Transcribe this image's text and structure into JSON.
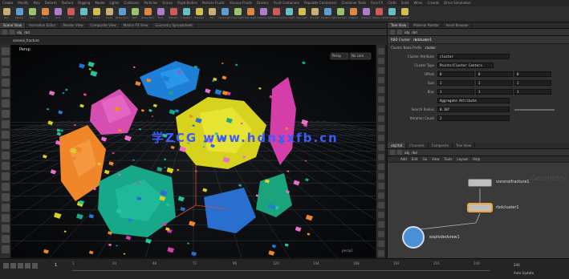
{
  "shelf": {
    "tabs": [
      "Create",
      "Modify",
      "Poly",
      "Deform",
      "Texture",
      "Rigging",
      "Model",
      "Lights",
      "Collisions",
      "Particles",
      "Grains",
      "Rigid Bodies",
      "Particle Fluids",
      "Viscous Fluids",
      "Oceans",
      "Fluid Containers",
      "Populate Containers",
      "Container Tools",
      "Pyro FX",
      "Cloth",
      "Solid",
      "Wires",
      "Crowds",
      "Drive Simulation"
    ],
    "tools": [
      "Box",
      "Sphere",
      "Tube",
      "Torus",
      "Grid",
      "Null",
      "Line",
      "Circle",
      "Curve",
      "Draw Curve",
      "Path",
      "Spray Paint",
      "Font",
      "Platonic",
      "L-System",
      "Metaball",
      "File",
      "Spot Light",
      "Area Light",
      "Geo Light",
      "Volume Light",
      "Distant Light",
      "Env Light",
      "Sky Light",
      "GI Light",
      "Caustic Light",
      "Portal Light",
      "Ambient",
      "Camera",
      "Stereo Cam",
      "VR Camera",
      "Switcher"
    ]
  },
  "scene_view": {
    "tabs": [
      "Scene View",
      "Animation Editor",
      "Render View",
      "Composite View",
      "Motion FX View",
      "Geometry Spreadsheet"
    ],
    "path": "voronoi_fracture",
    "obj_label": "obj",
    "node_label": "rbd",
    "viewport_title": "Persp",
    "camera_menu": "No cam",
    "watermark": "学ZCG  www.hdnxxfb.cn",
    "view_label": "persp1"
  },
  "params": {
    "tabs": [
      "Tree View",
      "Material Palette",
      "Asset Browser"
    ],
    "path_obj": "obj",
    "path_node": "rbd",
    "node_type": "RBD Cluster",
    "node_name": "rbdcluster1",
    "sub_label": "Cluster Node Prefix",
    "sub_value": "cluster",
    "rows": [
      {
        "label": "Cluster Attribute",
        "values": [
          "cluster"
        ]
      },
      {
        "label": "Cluster Type",
        "values": [
          "Points/Cluster Centers"
        ]
      },
      {
        "label": "Offset",
        "values": [
          "0",
          "0",
          "0"
        ]
      },
      {
        "label": "Size",
        "values": [
          "1",
          "1",
          "1"
        ]
      },
      {
        "label": "Bias",
        "values": [
          "1",
          "1",
          "1"
        ]
      },
      {
        "label": "",
        "values": [
          "Aggregate Attribute"
        ]
      },
      {
        "label": "Search Radius",
        "values": [
          "0.107"
        ]
      },
      {
        "label": "Iteration Count",
        "values": [
          "2"
        ]
      }
    ]
  },
  "network": {
    "tabs": [
      "obj/rbd",
      "Channels",
      "Composite",
      "Tree View"
    ],
    "path_obj": "obj",
    "path_node": "rbd",
    "menu": [
      "Add",
      "Edit",
      "Go",
      "View",
      "Tools",
      "Layout",
      "Help"
    ],
    "nodes": [
      {
        "name": "voronoifracture1"
      },
      {
        "name": "rbdcluster1"
      },
      {
        "name": "explodedview1"
      }
    ],
    "context_label": "Geometry"
  },
  "timeline": {
    "frame": "1",
    "ticks": [
      "1",
      "24",
      "48",
      "72",
      "96",
      "120",
      "144",
      "168",
      "192",
      "216",
      "240"
    ],
    "end_frame": "240",
    "status": "Auto Update"
  },
  "colors": {
    "accent": "#f0a23a",
    "watermark": "#3a5cff"
  }
}
